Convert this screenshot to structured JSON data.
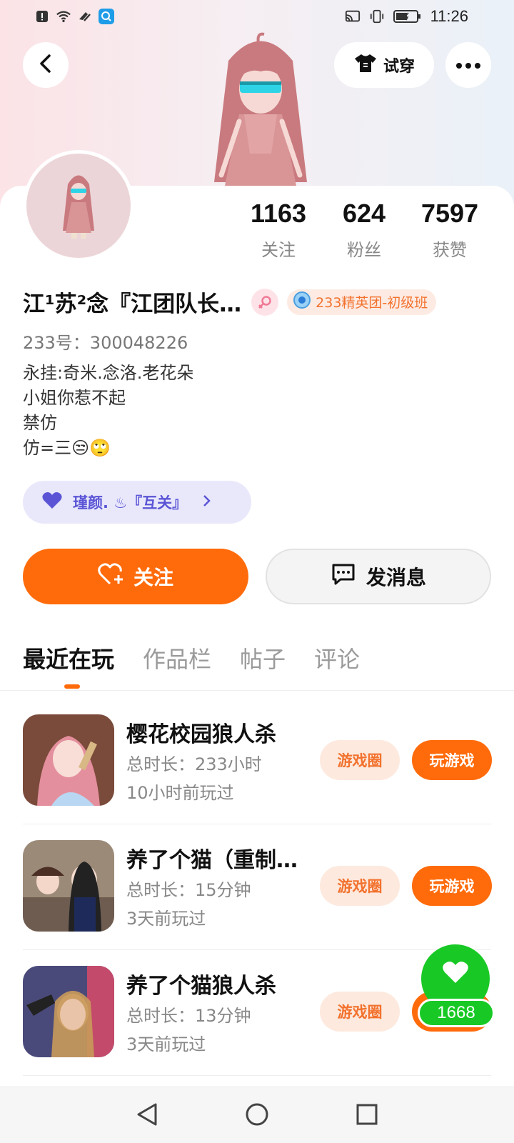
{
  "status_bar": {
    "time": "11:26",
    "icons": [
      "alert-icon",
      "wifi-icon",
      "nfc-icon",
      "app-search-icon",
      "cast-icon",
      "vibrate-icon",
      "battery-icon"
    ]
  },
  "header": {
    "try_on_label": "试穿"
  },
  "profile": {
    "stats": [
      {
        "value": "1163",
        "label": "关注"
      },
      {
        "value": "624",
        "label": "粉丝"
      },
      {
        "value": "7597",
        "label": "获赞"
      }
    ],
    "name": "江¹苏²念『江团队长…",
    "badge": "233精英团-初级班",
    "uid": "233号：300048226",
    "bio": [
      "永挂:奇米.念洛.老花朵",
      "小姐你惹不起",
      "禁仿",
      "仿=三😒🙄"
    ],
    "friend_pill": "瑾颜. ♨『互关』"
  },
  "actions": {
    "follow": "关注",
    "message": "发消息"
  },
  "tabs": [
    "最近在玩",
    "作品栏",
    "帖子",
    "评论"
  ],
  "games": [
    {
      "name": "樱花校园狼人杀",
      "duration": "总时长：233小时",
      "last_played": "10小时前玩过",
      "circle": "游戏圈",
      "play": "玩游戏"
    },
    {
      "name": "养了个猫（重制…",
      "duration": "总时长：15分钟",
      "last_played": "3天前玩过",
      "circle": "游戏圈",
      "play": "玩游戏"
    },
    {
      "name": "养了个猫狼人杀",
      "duration": "总时长：13分钟",
      "last_played": "3天前玩过",
      "circle": "游戏圈",
      "play": "玩游戏"
    }
  ],
  "like_fab": {
    "count": "1668"
  },
  "colors": {
    "accent": "#ff6b0b",
    "like_green": "#18c925",
    "friend_purple": "#5b55d6"
  }
}
